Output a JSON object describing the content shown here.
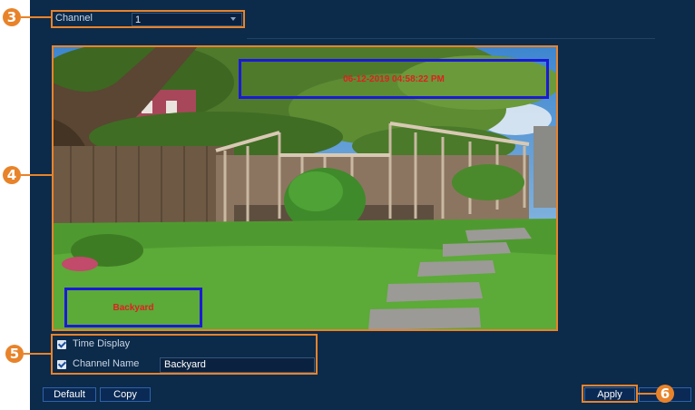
{
  "channel": {
    "label": "Channel",
    "value": "1"
  },
  "preview": {
    "timestamp": "06-12-2019 04:58:22 PM",
    "channel_name_overlay": "Backyard"
  },
  "options": {
    "time_display_label": "Time Display",
    "time_display_checked": true,
    "channel_name_label": "Channel Name",
    "channel_name_checked": true,
    "channel_name_value": "Backyard"
  },
  "buttons": {
    "default": "Default",
    "copy": "Copy",
    "apply": "Apply"
  },
  "callouts": {
    "channel": "3",
    "preview": "4",
    "options": "5",
    "apply": "6"
  },
  "colors": {
    "callout": "#e8832a",
    "panel": "#0c2a4a",
    "overlay_border": "#1a1ad6",
    "overlay_text": "#e02020"
  }
}
